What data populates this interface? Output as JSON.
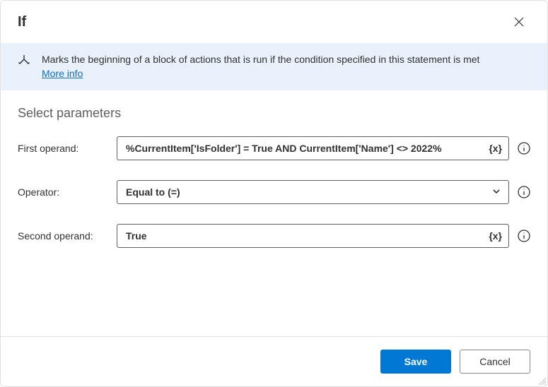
{
  "dialog": {
    "title": "If",
    "banner": {
      "description": "Marks the beginning of a block of actions that is run if the condition specified in this statement is met",
      "more_info": "More info"
    },
    "section_title": "Select parameters",
    "params": {
      "first_operand": {
        "label": "First operand:",
        "value": "%CurrentItem['IsFolder'] = True AND CurrentItem['Name'] <> 2022%",
        "var_badge": "{x}"
      },
      "operator": {
        "label": "Operator:",
        "value": "Equal to (=)"
      },
      "second_operand": {
        "label": "Second operand:",
        "value": "True",
        "var_badge": "{x}"
      }
    },
    "buttons": {
      "save": "Save",
      "cancel": "Cancel"
    }
  }
}
